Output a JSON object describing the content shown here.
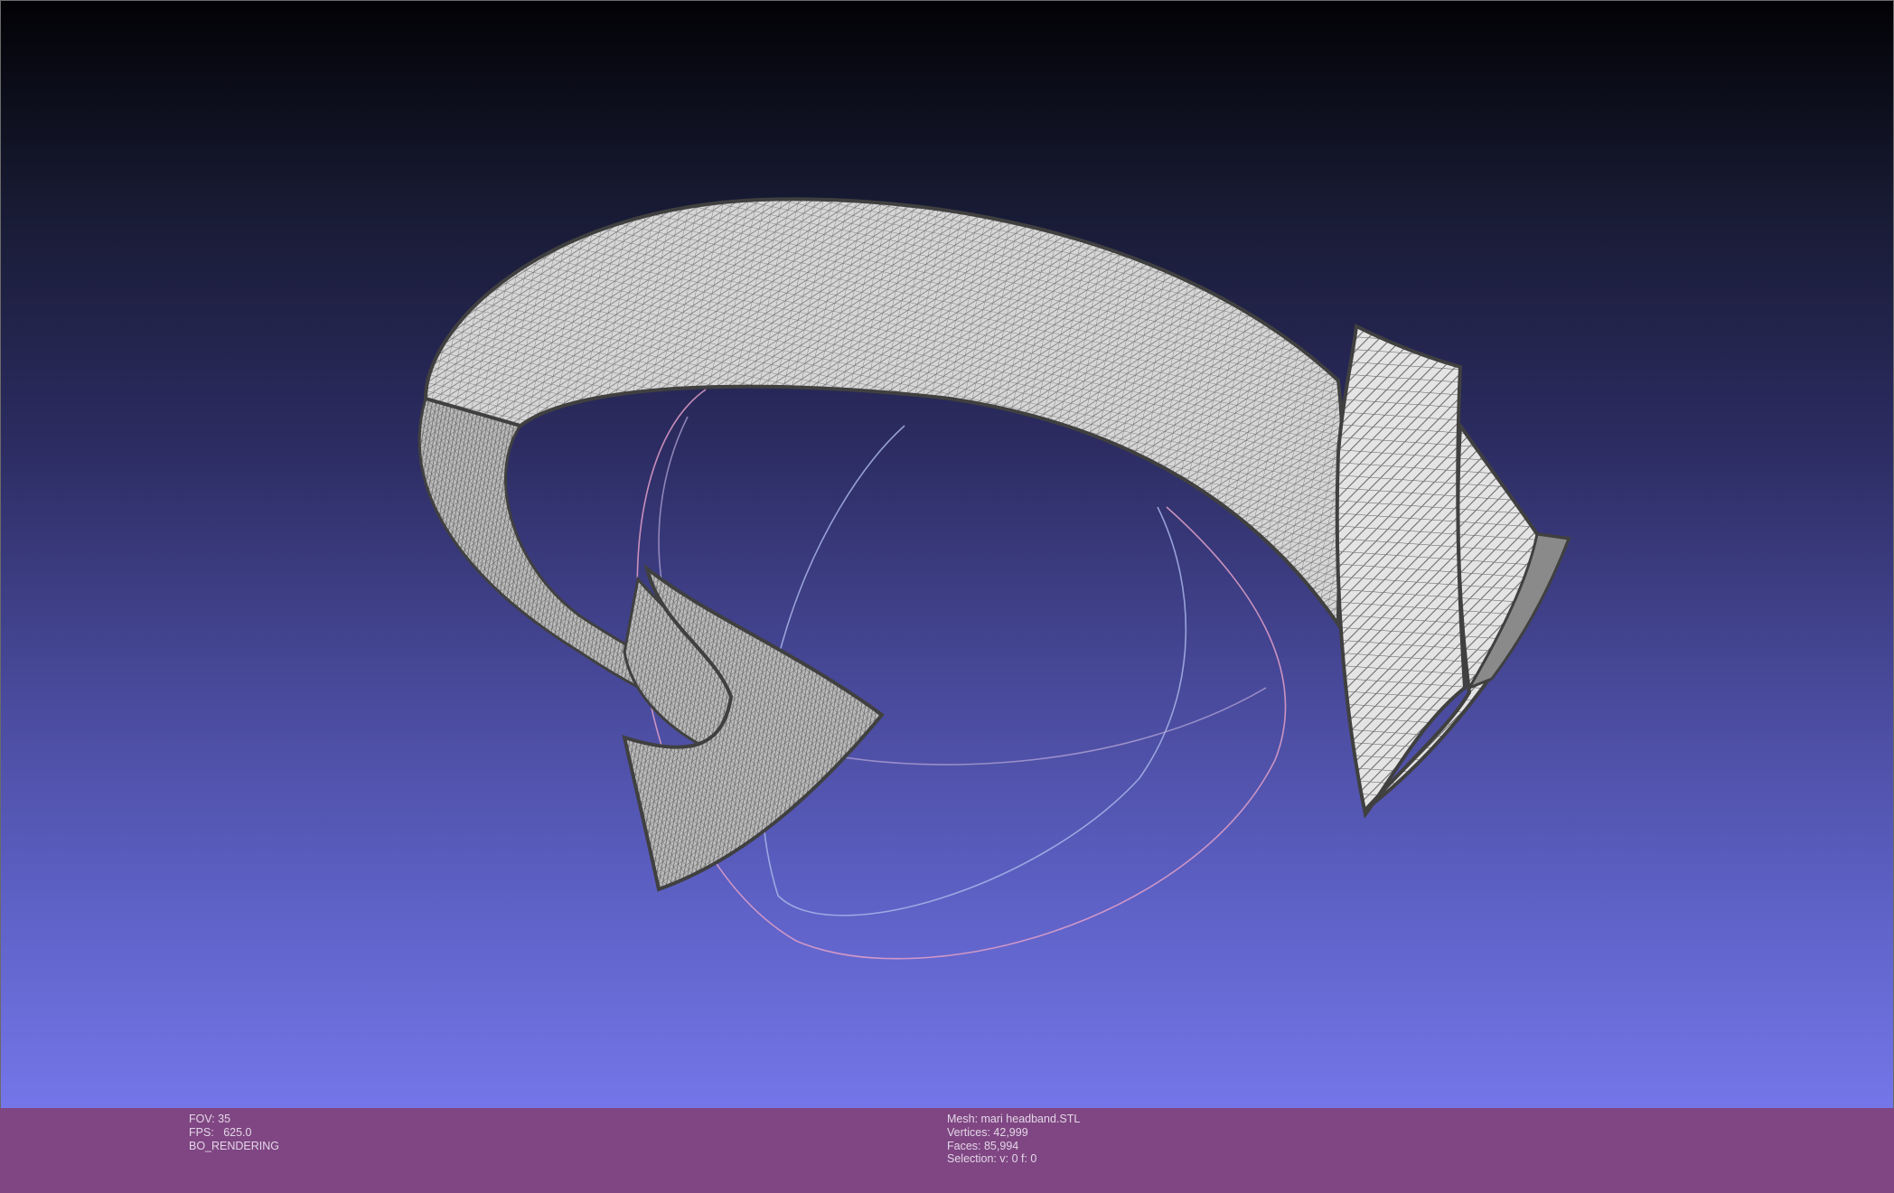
{
  "app": {
    "window_title": ""
  },
  "viewport": {
    "background_top": "#020205",
    "background_bottom": "#7476e9",
    "mesh_fill": "#d3d3d3",
    "mesh_edge": "#4a4a4a",
    "trackball_colors": [
      "#e2a0c8",
      "#a8b4e8",
      "#b8a8d8"
    ]
  },
  "statusbar": {
    "background": "#7f4683",
    "left": {
      "fov": "FOV: 35",
      "fps": "FPS:   625.0",
      "render_mode": "BO_RENDERING"
    },
    "right": {
      "mesh": "Mesh: mari headband.STL",
      "vertices": "Vertices: 42,999",
      "faces": "Faces: 85,994",
      "selection": "Selection: v: 0 f: 0"
    }
  }
}
